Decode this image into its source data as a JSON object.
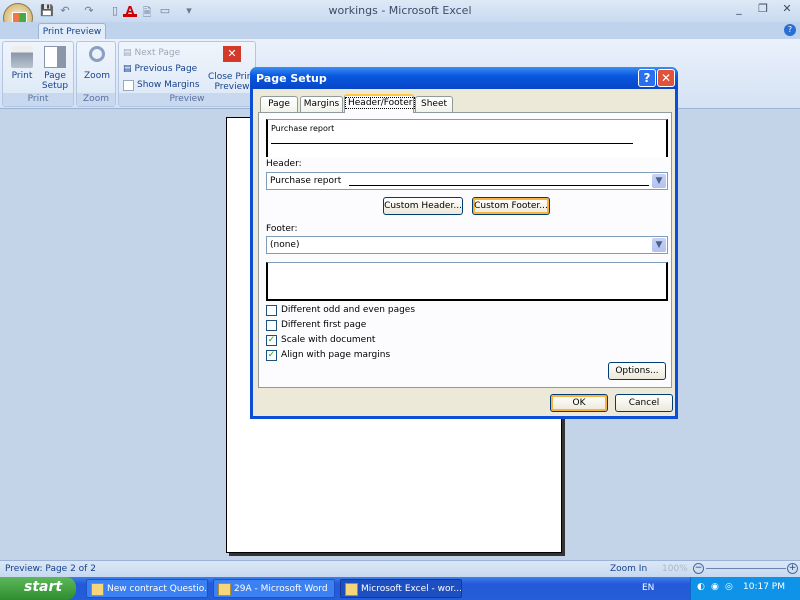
{
  "window": {
    "title": "workings - Microsoft Excel",
    "minimize": "_",
    "restore": "❐",
    "close": "✕",
    "help": "?"
  },
  "quick_access": {
    "save": "💾",
    "undo": "↶",
    "redo": "↷",
    "new": "▯",
    "font_color": "A",
    "print_preview": "🗎",
    "open": "▭",
    "customize": "▾"
  },
  "ribbon": {
    "tab": "Print Preview",
    "groups": {
      "print": "Print",
      "zoom": "Zoom",
      "preview": "Preview"
    },
    "print_label": "Print",
    "page_setup_label": "Page Setup",
    "zoom_label": "Zoom",
    "next_page": "Next Page",
    "previous_page": "Previous Page",
    "show_margins": "Show Margins",
    "show_margins_checked": false,
    "close_print_preview": "Close Print Preview"
  },
  "dialog": {
    "title": "Page Setup",
    "help": "?",
    "close": "✕",
    "tabs": [
      {
        "label": "Page"
      },
      {
        "label": "Margins"
      },
      {
        "label": "Header/Footer",
        "selected": true
      },
      {
        "label": "Sheet"
      }
    ],
    "header_preview_text": "Purchase report",
    "header_label": "Header:",
    "header_value": "Purchase report",
    "custom_header": "Custom Header...",
    "custom_footer": "Custom Footer...",
    "footer_label": "Footer:",
    "footer_value": "(none)",
    "options": [
      {
        "label": "Different odd and even pages",
        "checked": false
      },
      {
        "label": "Different first page",
        "checked": false
      },
      {
        "label": "Scale with document",
        "checked": true
      },
      {
        "label": "Align with page margins",
        "checked": true
      }
    ],
    "options_button": "Options...",
    "ok": "OK",
    "cancel": "Cancel"
  },
  "statusbar": {
    "text": "Preview: Page 2 of 2",
    "zoom_in": "Zoom In",
    "zoom_level": "100%"
  },
  "taskbar": {
    "start": "start",
    "tasks": [
      {
        "label": "New contract Questio..."
      },
      {
        "label": "29A - Microsoft Word"
      },
      {
        "label": "Microsoft Excel - wor...",
        "active": true
      }
    ],
    "language": "EN",
    "clock": "10:17 PM"
  }
}
